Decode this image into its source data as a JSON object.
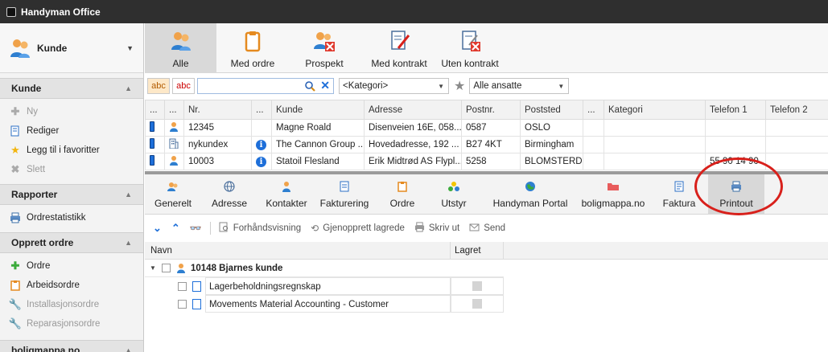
{
  "window": {
    "title": "Handyman Office"
  },
  "sidebar": {
    "module": {
      "label": "Kunde",
      "icon": "customers-icon"
    },
    "sections": [
      {
        "title": "Kunde",
        "items": [
          {
            "label": "Ny",
            "icon": "plus-icon",
            "enabled": false
          },
          {
            "label": "Rediger",
            "icon": "edit-icon",
            "enabled": true
          },
          {
            "label": "Legg til i favoritter",
            "icon": "star-icon",
            "enabled": true
          },
          {
            "label": "Slett",
            "icon": "delete-icon",
            "enabled": false
          }
        ]
      },
      {
        "title": "Rapporter",
        "items": [
          {
            "label": "Ordrestatistikk",
            "icon": "printer-icon",
            "enabled": true
          }
        ]
      },
      {
        "title": "Opprett ordre",
        "items": [
          {
            "label": "Ordre",
            "icon": "plus-icon",
            "enabled": true
          },
          {
            "label": "Arbeidsordre",
            "icon": "clipboard-icon",
            "enabled": true
          },
          {
            "label": "Installasjonsordre",
            "icon": "wrench-icon",
            "enabled": false
          },
          {
            "label": "Reparasjonsordre",
            "icon": "wrench-icon",
            "enabled": false
          }
        ]
      },
      {
        "title": "boligmappa.no",
        "items": []
      }
    ]
  },
  "toolbar": {
    "buttons": [
      {
        "label": "Alle",
        "icon": "customers-icon",
        "active": true
      },
      {
        "label": "Med ordre",
        "icon": "clipboard-icon",
        "active": false
      },
      {
        "label": "Prospekt",
        "icon": "prospect-icon",
        "active": false
      },
      {
        "label": "Med kontrakt",
        "icon": "contract-icon",
        "active": false
      },
      {
        "label": "Uten kontrakt",
        "icon": "no-contract-icon",
        "active": false
      }
    ]
  },
  "filter": {
    "abc1": "abc",
    "abc2": "abc",
    "search_value": "",
    "category": "<Kategori>",
    "employees": "Alle ansatte"
  },
  "grid": {
    "columns": [
      "...",
      "...",
      "Nr.",
      "...",
      "Kunde",
      "Adresse",
      "Postnr.",
      "Poststed",
      "...",
      "Kategori",
      "Telefon 1",
      "Telefon 2"
    ],
    "rows": [
      {
        "nr": "12345",
        "kunde": "Magne Roald",
        "adresse": "Disenveien 16E, 058...",
        "postnr": "0587",
        "poststed": "OSLO",
        "kategori": "",
        "tlf1": "",
        "tlf2": "",
        "type": "person",
        "info": false
      },
      {
        "nr": "nykundex",
        "kunde": "The Cannon Group ...",
        "adresse": "Hovedadresse, 192 ...",
        "postnr": "B27 4KT",
        "poststed": "Birmingham",
        "kategori": "",
        "tlf1": "",
        "tlf2": "",
        "type": "company",
        "info": true
      },
      {
        "nr": "10003",
        "kunde": "Statoil Flesland",
        "adresse": "Erik Midtrød AS Flypl...",
        "postnr": "5258",
        "poststed": "BLOMSTERD...",
        "kategori": "",
        "tlf1": "55 90 14 90",
        "tlf2": "",
        "type": "person",
        "info": true
      }
    ]
  },
  "detail_tabs": [
    {
      "label": "Generelt",
      "icon": "customer-card-icon"
    },
    {
      "label": "Adresse",
      "icon": "globe-icon"
    },
    {
      "label": "Kontakter",
      "icon": "person-icon"
    },
    {
      "label": "Fakturering",
      "icon": "invoice-icon"
    },
    {
      "label": "Ordre",
      "icon": "clipboard-icon"
    },
    {
      "label": "Utstyr",
      "icon": "equipment-icon"
    },
    {
      "label": "Handyman Portal",
      "icon": "portal-globe-icon"
    },
    {
      "label": "boligmappa.no",
      "icon": "folder-icon"
    },
    {
      "label": "Faktura",
      "icon": "invoice-doc-icon"
    },
    {
      "label": "Printout",
      "icon": "printer-icon",
      "active": true
    }
  ],
  "actions": {
    "preview": "Forhåndsvisning",
    "restore": "Gjenopprett lagrede",
    "print": "Skriv ut",
    "send": "Send"
  },
  "tree": {
    "col_name": "Navn",
    "col_saved": "Lagret",
    "root": "10148 Bjarnes kunde",
    "children": [
      "Lagerbeholdningsregnskap",
      "Movements Material Accounting - Customer"
    ]
  },
  "colors": {
    "titlebar": "#2f2f2f",
    "accent_blue": "#1e6fd9",
    "highlight_red": "#d8201b"
  }
}
